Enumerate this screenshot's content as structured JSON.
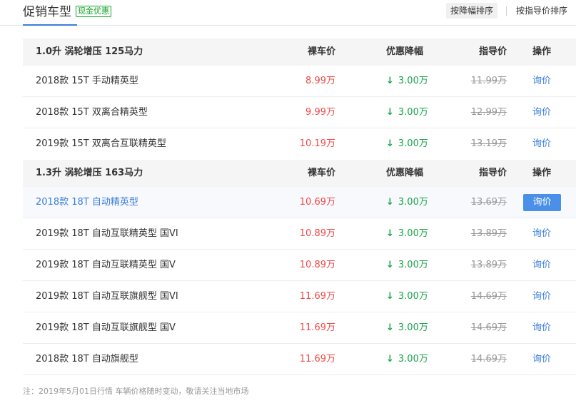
{
  "header": {
    "title": "促销车型",
    "badge": "现金优惠",
    "sort_by_drop": "按降幅排序",
    "sort_by_guide": "按指导价排序"
  },
  "columns": {
    "price": "裸车价",
    "discount": "优惠降幅",
    "guide": "指导价",
    "op": "操作"
  },
  "groups": [
    {
      "name": "1.0升 涡轮增压 125马力",
      "rows": [
        {
          "model": "2018款 15T 手动精英型",
          "price": "8.99万",
          "discount": "3.00万",
          "guide": "11.99万",
          "op": "询价"
        },
        {
          "model": "2018款 15T 双离合精英型",
          "price": "9.99万",
          "discount": "3.00万",
          "guide": "12.99万",
          "op": "询价"
        },
        {
          "model": "2019款 15T 双离合互联精英型",
          "price": "10.19万",
          "discount": "3.00万",
          "guide": "13.19万",
          "op": "询价"
        }
      ]
    },
    {
      "name": "1.3升 涡轮增压 163马力",
      "rows": [
        {
          "model": "2018款 18T 自动精英型",
          "price": "10.69万",
          "discount": "3.00万",
          "guide": "13.69万",
          "op": "询价"
        },
        {
          "model": "2019款 18T 自动互联精英型 国VI",
          "price": "10.89万",
          "discount": "3.00万",
          "guide": "13.89万",
          "op": "询价"
        },
        {
          "model": "2019款 18T 自动互联精英型 国V",
          "price": "10.89万",
          "discount": "3.00万",
          "guide": "13.89万",
          "op": "询价"
        },
        {
          "model": "2019款 18T 自动互联旗舰型 国VI",
          "price": "11.69万",
          "discount": "3.00万",
          "guide": "14.69万",
          "op": "询价"
        },
        {
          "model": "2019款 18T 自动互联旗舰型 国V",
          "price": "11.69万",
          "discount": "3.00万",
          "guide": "14.69万",
          "op": "询价"
        },
        {
          "model": "2018款 18T 自动旗舰型",
          "price": "11.69万",
          "discount": "3.00万",
          "guide": "14.69万",
          "op": "询价"
        }
      ]
    }
  ],
  "note": "注：2019年5月01日行情 车辆价格随时变动，敬请关注当地市场",
  "icons": {
    "discount_arrow": "down-arrow-icon"
  },
  "colors": {
    "accent": "#3b7ddd",
    "price": "#f04848",
    "discount": "#18a34a",
    "badge": "#17a62a"
  }
}
